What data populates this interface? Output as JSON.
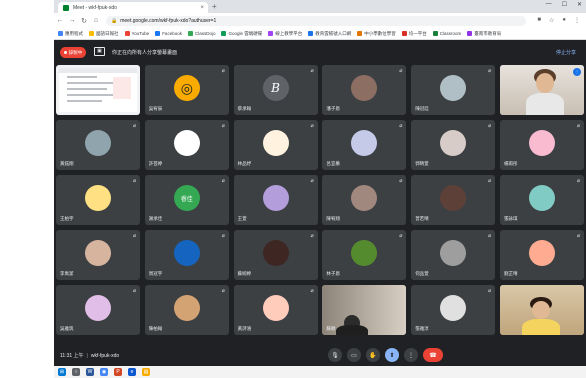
{
  "browser": {
    "tab_title": "Meet - wkf-fpuk-xdo",
    "url": "meet.google.com/wkf-fpuk-xdo?authuser=1",
    "bookmarks": [
      {
        "label": "應用程式",
        "color": "#4285f4"
      },
      {
        "label": "國語日報社",
        "color": "#fbbc04"
      },
      {
        "label": "YouTube",
        "color": "#ea4335"
      },
      {
        "label": "Facebook",
        "color": "#1877f2"
      },
      {
        "label": "ClassDojo",
        "color": "#34a853"
      },
      {
        "label": "Google 雲端硬碟",
        "color": "#0f9d58"
      },
      {
        "label": "線上教學平台",
        "color": "#a142f4"
      },
      {
        "label": "教育雲帳號入口網",
        "color": "#1a73e8"
      },
      {
        "label": "中小學數位學習",
        "color": "#e37400"
      },
      {
        "label": "均一平台",
        "color": "#d93025"
      },
      {
        "label": "Classroom",
        "color": "#188038"
      },
      {
        "label": "臺南市教育局",
        "color": "#9334e6"
      }
    ]
  },
  "meet": {
    "record_label": "錄製中",
    "presenting_text": "你正在向所有人分享螢幕畫面",
    "stop_label": "停止分享",
    "time": "11:31 上午",
    "meeting_code": "wkf-fpuk-xdo"
  },
  "tiles": [
    {
      "kind": "slide",
      "name": ""
    },
    {
      "kind": "avatar",
      "name": "吳宥辰",
      "bg": "#f9ab00",
      "glyph": "◎"
    },
    {
      "kind": "avatar",
      "name": "蔡承翰",
      "bg": "#5f6368",
      "glyph": "B"
    },
    {
      "kind": "avatar",
      "name": "潘子恩",
      "bg": "#8d6e63",
      "glyph": ""
    },
    {
      "kind": "avatar",
      "name": "陳冠廷",
      "bg": "#b0bec5",
      "glyph": ""
    },
    {
      "kind": "camera",
      "name": "",
      "highlight": true
    },
    {
      "kind": "avatar",
      "name": "黃鈺翔",
      "bg": "#90a4ae",
      "glyph": ""
    },
    {
      "kind": "avatar",
      "name": "許芸婷",
      "bg": "#ffffff",
      "glyph": ""
    },
    {
      "kind": "avatar",
      "name": "林品妤",
      "bg": "#fff3e0",
      "glyph": ""
    },
    {
      "kind": "avatar",
      "name": "呂宜蓁",
      "bg": "#c5cae9",
      "glyph": ""
    },
    {
      "kind": "avatar",
      "name": "郭晴萱",
      "bg": "#d7ccc8",
      "glyph": ""
    },
    {
      "kind": "avatar",
      "name": "楊雨彤",
      "bg": "#f8bbd0",
      "glyph": ""
    },
    {
      "kind": "avatar",
      "name": "王柏宇",
      "bg": "#ffe082",
      "glyph": ""
    },
    {
      "kind": "avatar",
      "name": "謝承佳",
      "bg": "#34a853",
      "glyph": "睿佳"
    },
    {
      "kind": "avatar",
      "name": "王萱",
      "bg": "#b39ddb",
      "glyph": ""
    },
    {
      "kind": "avatar",
      "name": "陳宥翔",
      "bg": "#a1887f",
      "glyph": ""
    },
    {
      "kind": "avatar",
      "name": "曾若晴",
      "bg": "#5d4037",
      "glyph": ""
    },
    {
      "kind": "avatar",
      "name": "張詠琪",
      "bg": "#80cbc4",
      "glyph": ""
    },
    {
      "kind": "avatar",
      "name": "李禹潔",
      "bg": "#d7b49e",
      "glyph": ""
    },
    {
      "kind": "avatar",
      "name": "周冠宇",
      "bg": "#1565c0",
      "glyph": ""
    },
    {
      "kind": "avatar",
      "name": "蘇婉婷",
      "bg": "#3e2723",
      "glyph": ""
    },
    {
      "kind": "avatar",
      "name": "林子恩",
      "bg": "#558b2f",
      "glyph": ""
    },
    {
      "kind": "avatar",
      "name": "何品萱",
      "bg": "#9e9e9e",
      "glyph": ""
    },
    {
      "kind": "avatar",
      "name": "劉芷晴",
      "bg": "#ffab91",
      "glyph": ""
    },
    {
      "kind": "avatar",
      "name": "吳雅筑",
      "bg": "#e1bee7",
      "glyph": ""
    },
    {
      "kind": "avatar",
      "name": "陳柏翰",
      "bg": "#d4a373",
      "glyph": ""
    },
    {
      "kind": "avatar",
      "name": "黃詩涵",
      "bg": "#ffccbc",
      "glyph": ""
    },
    {
      "kind": "camera2",
      "name": "蘇穎",
      "highlight": false
    },
    {
      "kind": "avatar",
      "name": "張雅淳",
      "bg": "#e0e0e0",
      "glyph": ""
    },
    {
      "kind": "camera3",
      "name": "",
      "highlight": false
    }
  ],
  "controls": [
    {
      "name": "mic-button",
      "glyph": "🎙",
      "style": ""
    },
    {
      "name": "camera-button",
      "glyph": "▭",
      "style": ""
    },
    {
      "name": "raise-hand-button",
      "glyph": "✋",
      "style": ""
    },
    {
      "name": "present-button",
      "glyph": "⬆",
      "style": "blue"
    },
    {
      "name": "more-options-button",
      "glyph": "⋮",
      "style": ""
    },
    {
      "name": "leave-call-button",
      "glyph": "☎",
      "style": "end"
    }
  ],
  "colors": {
    "meet_bg": "#202124",
    "tile_bg": "#3c4043",
    "end_call": "#ea4335",
    "accent": "#8ab4f8"
  }
}
